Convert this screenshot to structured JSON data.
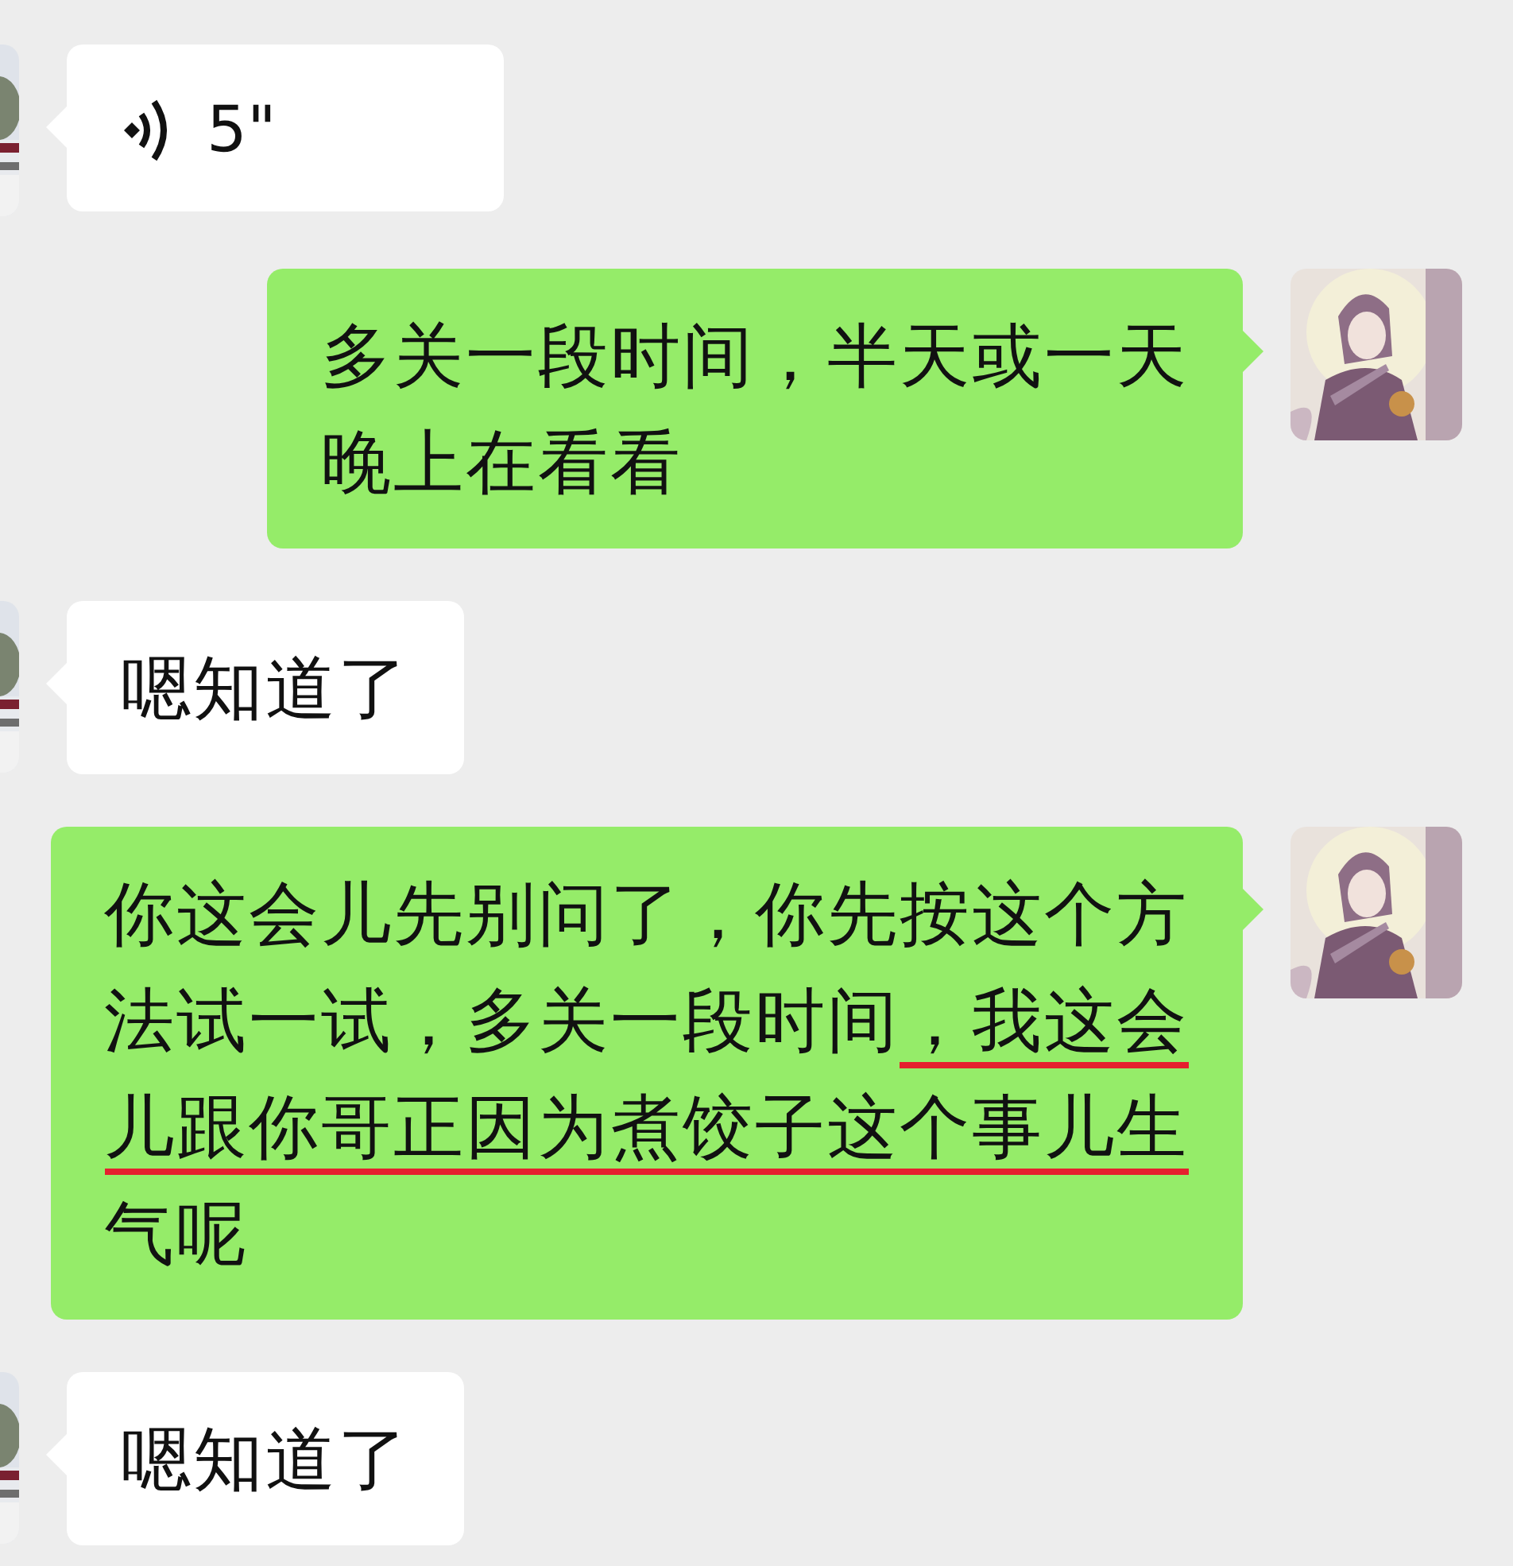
{
  "messages": [
    {
      "kind": "voice",
      "sent": false,
      "duration": "5\""
    },
    {
      "kind": "text",
      "sent": true,
      "lines": [
        [
          {
            "text": "多关一段时间，半天或一天",
            "underlined": false
          }
        ],
        [
          {
            "text": "晚上在看看",
            "underlined": false
          }
        ]
      ]
    },
    {
      "kind": "text",
      "sent": false,
      "lines": [
        [
          {
            "text": "嗯知道了",
            "underlined": false
          }
        ]
      ]
    },
    {
      "kind": "text",
      "sent": true,
      "lines": [
        [
          {
            "text": "你这会儿先别问了，你先按这个方",
            "underlined": false
          }
        ],
        [
          {
            "text": "法试一试，多关一段时间",
            "underlined": false
          },
          {
            "text": "，我这会",
            "underlined": true
          }
        ],
        [
          {
            "text": "儿跟你哥正因为煮饺子这个事儿生",
            "underlined": true
          }
        ],
        [
          {
            "text": "气呢",
            "underlined": false
          }
        ]
      ]
    },
    {
      "kind": "text",
      "sent": false,
      "lines": [
        [
          {
            "text": "嗯知道了",
            "underlined": false
          }
        ]
      ]
    }
  ]
}
